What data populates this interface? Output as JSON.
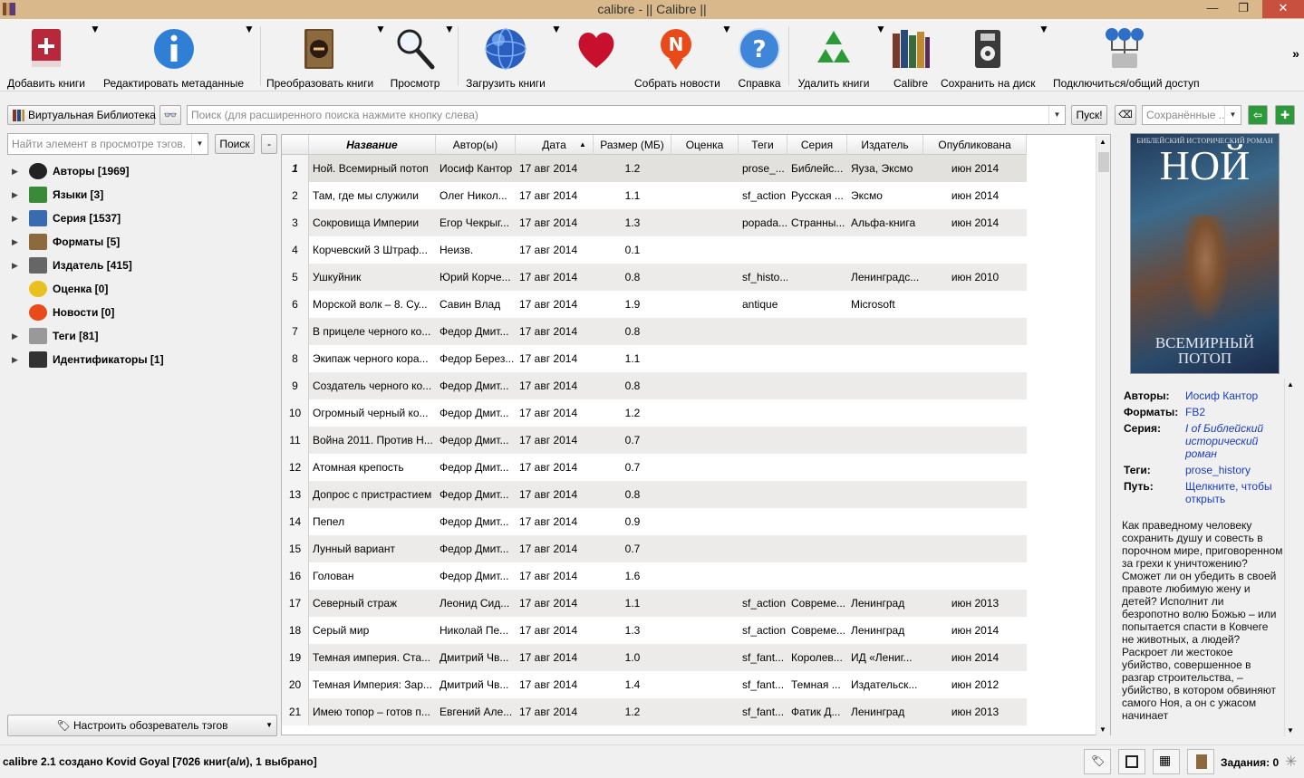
{
  "window": {
    "title": "calibre - || Calibre ||",
    "min": "—",
    "max": "❐",
    "close": "✕"
  },
  "toolbar": {
    "add": "Добавить книги",
    "edit": "Редактировать метаданные",
    "convert": "Преобразовать книги",
    "view": "Просмотр",
    "get": "Загрузить книги",
    "news": "Собрать новости",
    "help": "Справка",
    "remove": "Удалить книги",
    "calibre": "Calibre",
    "save": "Сохранить на диск",
    "connect": "Подключиться/общий доступ",
    "more": "»"
  },
  "search": {
    "vlib": "Виртуальная Библиотека",
    "placeholder": "Поиск (для расширенного поиска нажмите кнопку слева)",
    "go": "Пуск!",
    "saved": "Сохранённые ..."
  },
  "tagbrowser": {
    "find_placeholder": "Найти элемент в просмотре тэгов.",
    "find_button": "Поиск",
    "collapse": "-",
    "items": [
      {
        "label": "Авторы [1969]",
        "icon": "user-icon",
        "expandable": true
      },
      {
        "label": "Языки [3]",
        "icon": "languages-icon",
        "expandable": true
      },
      {
        "label": "Серия [1537]",
        "icon": "series-icon",
        "expandable": true
      },
      {
        "label": "Форматы [5]",
        "icon": "formats-icon",
        "expandable": true
      },
      {
        "label": "Издатель [415]",
        "icon": "publisher-icon",
        "expandable": true
      },
      {
        "label": "Оценка [0]",
        "icon": "star-icon",
        "expandable": false
      },
      {
        "label": "Новости [0]",
        "icon": "news-icon",
        "expandable": false
      },
      {
        "label": "Теги [81]",
        "icon": "tag-icon",
        "expandable": true
      },
      {
        "label": "Идентификаторы [1]",
        "icon": "barcode-icon",
        "expandable": true
      }
    ],
    "configure": "Настроить обозреватель тэгов"
  },
  "books": {
    "headers": [
      "Название",
      "Автор(ы)",
      "Дата",
      "Размер (МБ)",
      "Оценка",
      "Теги",
      "Серия",
      "Издатель",
      "Опубликована"
    ],
    "rows": [
      [
        "1",
        "Ной. Всемирный потоп",
        "Иосиф Кантор",
        "17 авг 2014",
        "1.2",
        "",
        "prose_...",
        "Библейс...",
        "Яуза, Эксмо",
        "июн 2014"
      ],
      [
        "2",
        "Там, где мы служили",
        "Олег Никол...",
        "17 авг 2014",
        "1.1",
        "",
        "sf_action",
        "Русская ...",
        "Эксмо",
        "июн 2014"
      ],
      [
        "3",
        "Сокровища Империи",
        "Егор Чекрыг...",
        "17 авг 2014",
        "1.3",
        "",
        "popada...",
        "Странны...",
        "Альфа-книга",
        "июн 2014"
      ],
      [
        "4",
        "Корчевский 3 Штраф...",
        "Неизв.",
        "17 авг 2014",
        "0.1",
        "",
        "",
        "",
        "",
        ""
      ],
      [
        "5",
        "Ушкуйник",
        "Юрий Корче...",
        "17 авг 2014",
        "0.8",
        "",
        "sf_histo...",
        "",
        "Ленинградс...",
        "июн 2010"
      ],
      [
        "6",
        "Морской волк – 8. Су...",
        "Савин Влад",
        "17 авг 2014",
        "1.9",
        "",
        "antique",
        "",
        "Microsoft",
        ""
      ],
      [
        "7",
        "В прицеле черного ко...",
        "Федор Дмит...",
        "17 авг 2014",
        "0.8",
        "",
        "",
        "",
        "",
        ""
      ],
      [
        "8",
        "Экипаж черного кора...",
        "Федор Берез...",
        "17 авг 2014",
        "1.1",
        "",
        "",
        "",
        "",
        ""
      ],
      [
        "9",
        "Создатель черного ко...",
        "Федор Дмит...",
        "17 авг 2014",
        "0.8",
        "",
        "",
        "",
        "",
        ""
      ],
      [
        "10",
        "Огромный черный ко...",
        "Федор Дмит...",
        "17 авг 2014",
        "1.2",
        "",
        "",
        "",
        "",
        ""
      ],
      [
        "11",
        "Война 2011. Против Н...",
        "Федор Дмит...",
        "17 авг 2014",
        "0.7",
        "",
        "",
        "",
        "",
        ""
      ],
      [
        "12",
        "Атомная крепость",
        "Федор Дмит...",
        "17 авг 2014",
        "0.7",
        "",
        "",
        "",
        "",
        ""
      ],
      [
        "13",
        "Допрос с пристрастием",
        "Федор Дмит...",
        "17 авг 2014",
        "0.8",
        "",
        "",
        "",
        "",
        ""
      ],
      [
        "14",
        "Пепел",
        "Федор Дмит...",
        "17 авг 2014",
        "0.9",
        "",
        "",
        "",
        "",
        ""
      ],
      [
        "15",
        "Лунный вариант",
        "Федор Дмит...",
        "17 авг 2014",
        "0.7",
        "",
        "",
        "",
        "",
        ""
      ],
      [
        "16",
        "Голован",
        "Федор Дмит...",
        "17 авг 2014",
        "1.6",
        "",
        "",
        "",
        "",
        ""
      ],
      [
        "17",
        "Северный страж",
        "Леонид Сид...",
        "17 авг 2014",
        "1.1",
        "",
        "sf_action",
        "Совреме...",
        "Ленинград",
        "июн 2013"
      ],
      [
        "18",
        "Серый мир",
        "Николай Пе...",
        "17 авг 2014",
        "1.3",
        "",
        "sf_action",
        "Совреме...",
        "Ленинград",
        "июн 2014"
      ],
      [
        "19",
        "Темная империя. Ста...",
        "Дмитрий Чв...",
        "17 авг 2014",
        "1.0",
        "",
        "sf_fant...",
        "Королев...",
        "ИД «Лениг...",
        "июн 2014"
      ],
      [
        "20",
        "Темная Империя: Зар...",
        "Дмитрий Чв...",
        "17 авг 2014",
        "1.4",
        "",
        "sf_fant...",
        "Темная ...",
        "Издательск...",
        "июн 2012"
      ],
      [
        "21",
        "Имею топор – готов п...",
        "Евгений Але...",
        "17 авг 2014",
        "1.2",
        "",
        "sf_fant...",
        "Фатик Д...",
        "Ленинград",
        "июн 2013"
      ]
    ]
  },
  "details": {
    "cover_top": "БИБЛЕЙСКИЙ ИСТОРИЧЕСКИЙ РОМАН",
    "cover_title": "НОЙ",
    "cover_sub": "ВСЕМИРНЫЙ ПОТОП",
    "authors_k": "Авторы:",
    "authors_v": "Иосиф Кантор",
    "formats_k": "Форматы:",
    "formats_v": "FB2",
    "series_k": "Серия:",
    "series_v": "I of Библейский исторический роман",
    "tags_k": "Теги:",
    "tags_v": "prose_history",
    "path_k": "Путь:",
    "path_v": "Щелкните, чтобы открыть",
    "description": "Как праведному человеку сохранить душу и совесть в порочном мире, приговоренном за грехи к уничтожению? Сможет ли он убедить в своей правоте любимую жену и детей? Исполнит ли безропотно волю Божью – или попытается спасти в Ковчеге не животных, а людей? Раскроет ли жестокое убийство, совершенное в разгар строительства, – убийство, в котором обвиняют самого Ноя, а он с ужасом начинает"
  },
  "status": {
    "text": "calibre 2.1 создано Kovid Goyal    [7026 книг(а/и), 1 выбрано]",
    "jobs": "Задания: 0"
  }
}
